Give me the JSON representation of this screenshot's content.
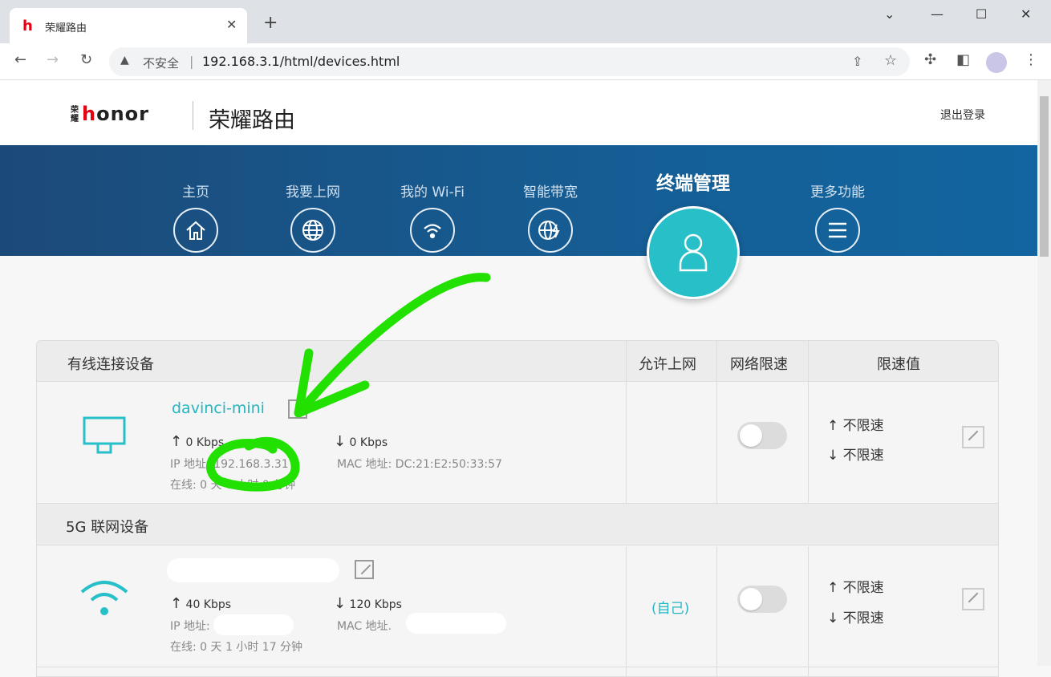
{
  "browser": {
    "tab_title": "荣耀路由",
    "insecure_label": "不安全",
    "url": "192.168.3.1/html/devices.html"
  },
  "header": {
    "logo_text": "honor",
    "logo_small": "荣耀",
    "brand": "荣耀路由",
    "logout": "退出登录"
  },
  "nav": [
    {
      "label": "主页",
      "icon": "home-icon"
    },
    {
      "label": "我要上网",
      "icon": "globe-icon"
    },
    {
      "label": "我的 Wi-Fi",
      "icon": "wifi-icon"
    },
    {
      "label": "智能带宽",
      "icon": "bandwidth-icon"
    },
    {
      "label": "终端管理",
      "icon": "user-icon",
      "active": true
    },
    {
      "label": "更多功能",
      "icon": "menu-icon"
    }
  ],
  "table": {
    "columns": [
      "有线连接设备",
      "允许上网",
      "网络限速",
      "限速值"
    ],
    "sections": [
      {
        "title": "有线连接设备",
        "device": {
          "name": "davinci-mini",
          "up": "0 Kbps",
          "down": "0 Kbps",
          "ip": "IP 地址: 192.168.3.31",
          "mac": "MAC 地址: DC:21:E2:50:33:57",
          "online": "在线: 0 天 0 小时 0 分钟",
          "allowed": "",
          "up_limit": "不限速",
          "down_limit": "不限速",
          "limit_enabled": false
        }
      },
      {
        "title": "5G 联网设备",
        "device": {
          "name": "",
          "up": "40 Kbps",
          "down": "120 Kbps",
          "ip": "IP 地址:",
          "mac": "MAC 地址.",
          "online": "在线: 0 天 1 小时 17 分钟",
          "allowed": "(自己)",
          "up_limit": "不限速",
          "down_limit": "不限速",
          "limit_enabled": false
        }
      }
    ]
  },
  "colors": {
    "accent": "#27bfc8",
    "annotation": "#22e000"
  }
}
